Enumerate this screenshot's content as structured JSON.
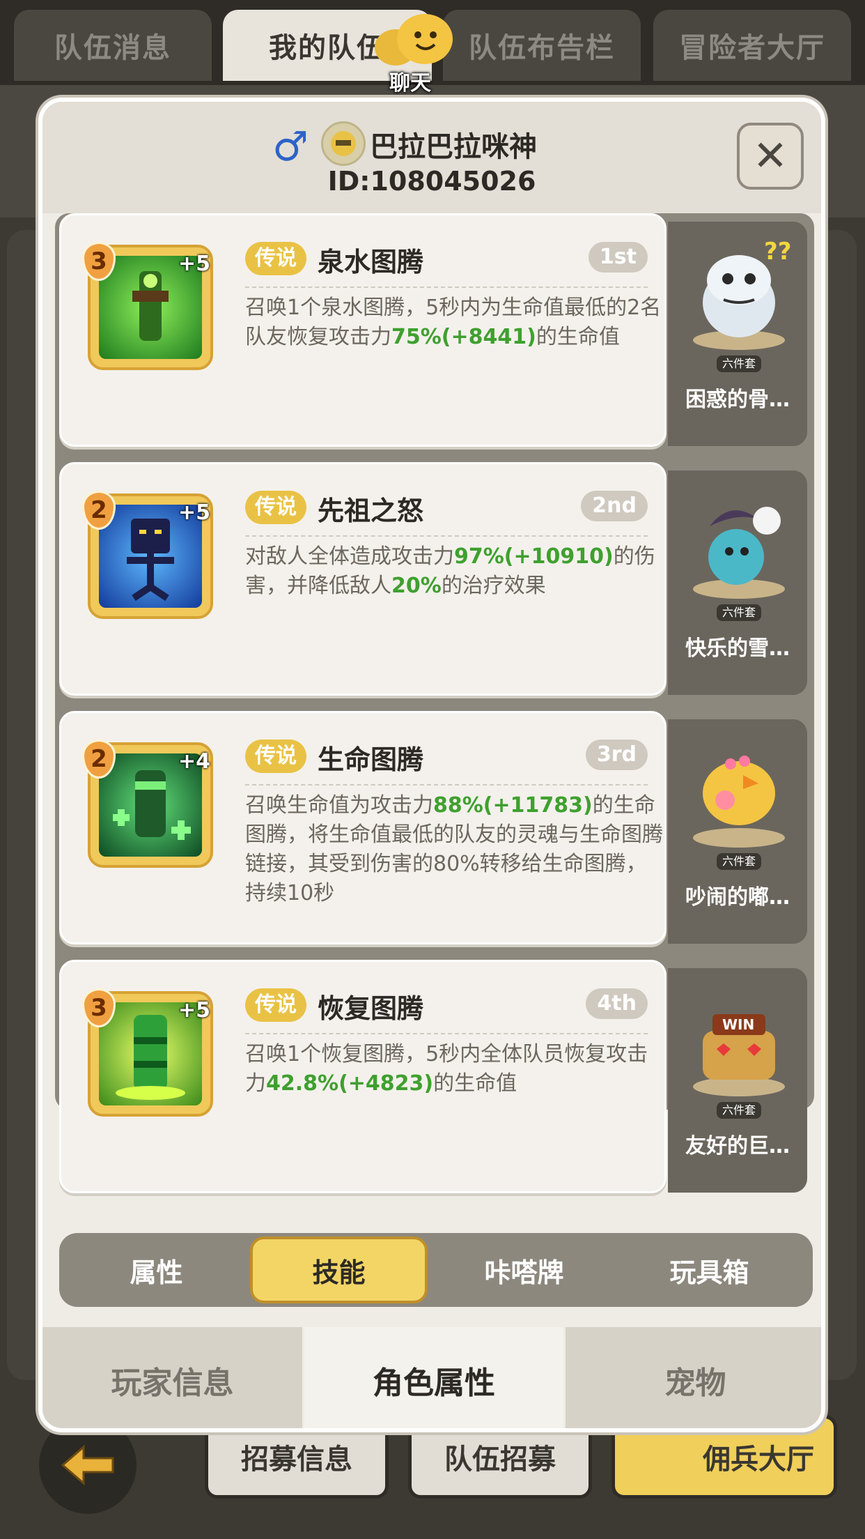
{
  "top_tabs": [
    {
      "label": "队伍消息"
    },
    {
      "label": "我的队伍"
    },
    {
      "label": "队伍布告栏"
    },
    {
      "label": "冒险者大厅"
    }
  ],
  "chat": {
    "label": "聊天",
    "icon": "chat-bubble-icon"
  },
  "player": {
    "gender": "♂",
    "name": "巴拉巴拉咪神",
    "id": "ID:108045026"
  },
  "close_icon": "✕",
  "skills": [
    {
      "level": "3",
      "plus": "+5",
      "rarity": "传说",
      "name": "泉水图腾",
      "rank": "1st",
      "desc": [
        "召唤1个泉水图腾，5秒内为生命值最低的2名队友恢复攻击力",
        "75%(+8441)",
        "的生命值"
      ],
      "pet_set": "六件套",
      "pet_name": "困惑的骨…",
      "icon_color": "#4fcf3a"
    },
    {
      "level": "2",
      "plus": "+5",
      "rarity": "传说",
      "name": "先祖之怒",
      "rank": "2nd",
      "desc": [
        "对敌人全体造成攻击力",
        "97%(+10910)",
        "的伤害，并降低敌人",
        "20%",
        "的治疗效果"
      ],
      "pet_set": "六件套",
      "pet_name": "快乐的雪…",
      "icon_color": "#2c6cd8"
    },
    {
      "level": "2",
      "plus": "+4",
      "rarity": "传说",
      "name": "生命图腾",
      "rank": "3rd",
      "desc": [
        "召唤生命值为攻击力",
        "88%(+11783)",
        "的生命图腾，将生命值最低的队友的灵魂与生命图腾链接，其受到伤害的80%转移给生命图腾，持续10秒"
      ],
      "pet_set": "六件套",
      "pet_name": "吵闹的嘟…",
      "icon_color": "#27b04a"
    },
    {
      "level": "3",
      "plus": "+5",
      "rarity": "传说",
      "name": "恢复图腾",
      "rank": "4th",
      "desc": [
        "召唤1个恢复图腾，5秒内全体队员恢复攻击力",
        "42.8%(+4823)",
        "的生命值"
      ],
      "pet_set": "六件套",
      "pet_name": "友好的巨…",
      "icon_color": "#7ad83a"
    }
  ],
  "sub_tabs": [
    {
      "label": "属性"
    },
    {
      "label": "技能"
    },
    {
      "label": "咔嗒牌"
    },
    {
      "label": "玩具箱"
    }
  ],
  "main_tabs": [
    {
      "label": "玩家信息"
    },
    {
      "label": "角色属性"
    },
    {
      "label": "宠物"
    }
  ],
  "bottom_buttons": [
    {
      "label": "招募信息"
    },
    {
      "label": "队伍招募"
    },
    {
      "label": "佣兵大厅"
    }
  ],
  "colors": {
    "accent_gold": "#f3d566",
    "green_value": "#3fa02f",
    "rarity_gold": "#e9c245"
  }
}
